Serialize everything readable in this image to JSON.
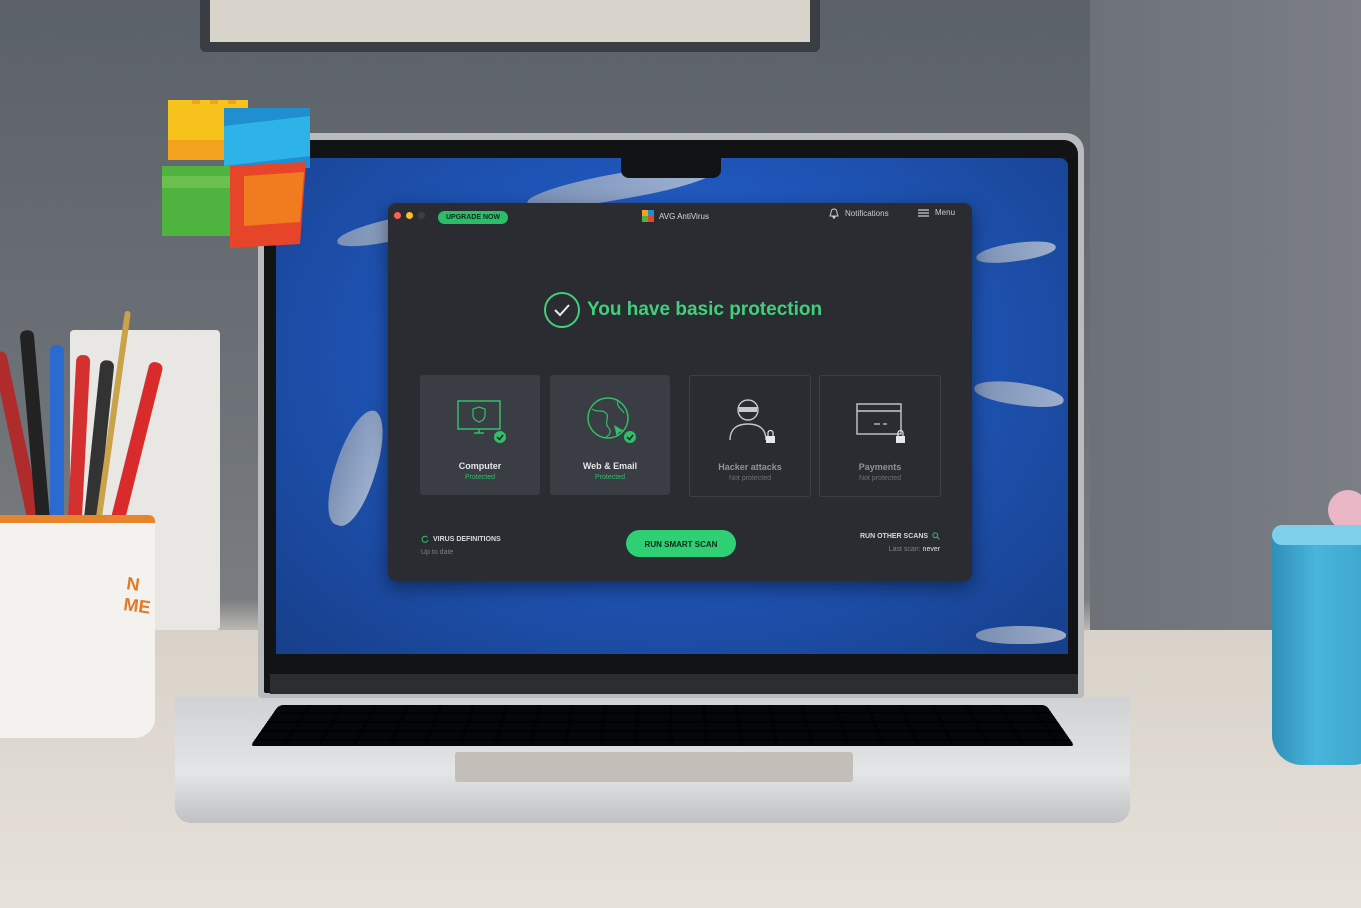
{
  "app": {
    "title": "AVG AntiVirus",
    "upgrade_label": "UPGRADE NOW",
    "notifications_label": "Notifications",
    "menu_label": "Menu",
    "status_title": "You have basic protection",
    "tiles": [
      {
        "label": "Computer",
        "status": "Protected",
        "icon": "monitor-shield-icon"
      },
      {
        "label": "Web & Email",
        "status": "Protected",
        "icon": "globe-cursor-icon"
      },
      {
        "label": "Hacker attacks",
        "status": "Not protected",
        "icon": "hacker-icon"
      },
      {
        "label": "Payments",
        "status": "Not protected",
        "icon": "credit-card-icon"
      }
    ],
    "virus_definitions": {
      "title": "VIRUS DEFINITIONS",
      "status": "Up to date"
    },
    "scan_button": "RUN SMART SCAN",
    "other_scans": {
      "title": "RUN OTHER SCANS",
      "last_scan_label": "Last scan:",
      "last_scan_value": "never"
    }
  },
  "colors": {
    "accent": "#2fcf74",
    "window_bg": "#2a2c31",
    "tile_bg": "#3a3d43",
    "desktop_blue": "#1f55b8"
  },
  "decor": {
    "cup_text": "N\nME"
  }
}
